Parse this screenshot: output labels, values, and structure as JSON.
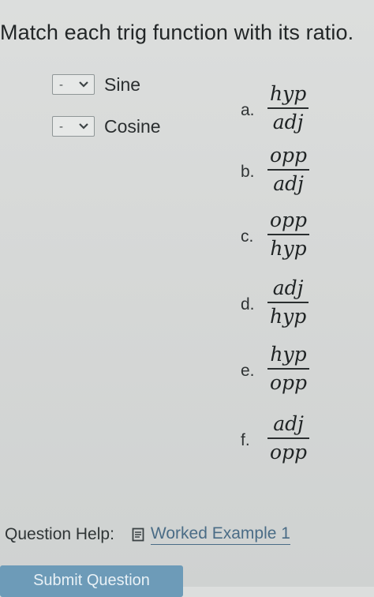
{
  "question": {
    "title": "Match each trig function with its ratio."
  },
  "rows": [
    {
      "selected": "-",
      "label": "Sine",
      "icon": "chevron-down-icon"
    },
    {
      "selected": "-",
      "label": "Cosine",
      "icon": "chevron-down-icon"
    }
  ],
  "options": [
    {
      "letter": "a.",
      "numerator": "hyp",
      "denominator": "adj"
    },
    {
      "letter": "b.",
      "numerator": "opp",
      "denominator": "adj"
    },
    {
      "letter": "c.",
      "numerator": "opp",
      "denominator": "hyp"
    },
    {
      "letter": "d.",
      "numerator": "adj",
      "denominator": "hyp"
    },
    {
      "letter": "e.",
      "numerator": "hyp",
      "denominator": "opp"
    },
    {
      "letter": "f.",
      "numerator": "adj",
      "denominator": "opp"
    }
  ],
  "help": {
    "label": "Question Help:",
    "link_icon": "document-icon",
    "link_text": "Worked Example 1"
  },
  "submit": {
    "label": "Submit Question"
  },
  "colors": {
    "background": "#d8dad9",
    "link": "#4a6c86",
    "submit_button": "#6d9bb8"
  }
}
